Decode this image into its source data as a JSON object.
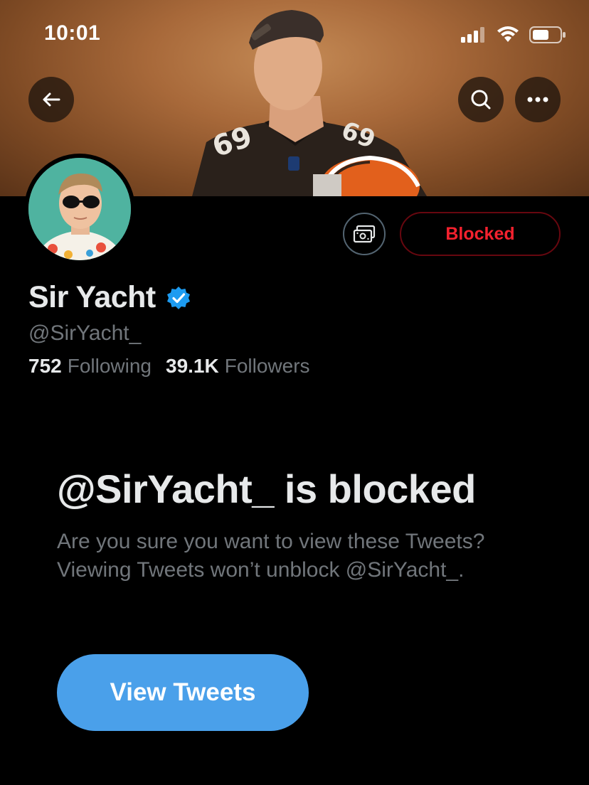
{
  "status_bar": {
    "time": "10:01",
    "icons": [
      "signal-icon",
      "wifi-icon",
      "battery-icon"
    ]
  },
  "header": {
    "back_icon": "arrow-left-icon",
    "search_icon": "search-icon",
    "more_icon": "more-horizontal-icon"
  },
  "profile": {
    "display_name": "Sir Yacht",
    "verified": true,
    "handle": "@SirYacht_",
    "following_count": "752",
    "following_label": "Following",
    "followers_count": "39.1K",
    "followers_label": "Followers",
    "tip_icon": "money-icon",
    "blocked_button_label": "Blocked"
  },
  "blocked_notice": {
    "title": "@SirYacht_ is blocked",
    "description": "Are you sure you want to view these Tweets? Viewing Tweets won’t unblock @SirYacht_.",
    "view_button_label": "View Tweets"
  },
  "colors": {
    "background": "#000000",
    "primary_text": "#e7e9ea",
    "secondary_text": "#71767b",
    "blocked_red": "#f4212e",
    "accent_blue": "#4aa0ea",
    "verified_blue": "#1d9bf0"
  }
}
